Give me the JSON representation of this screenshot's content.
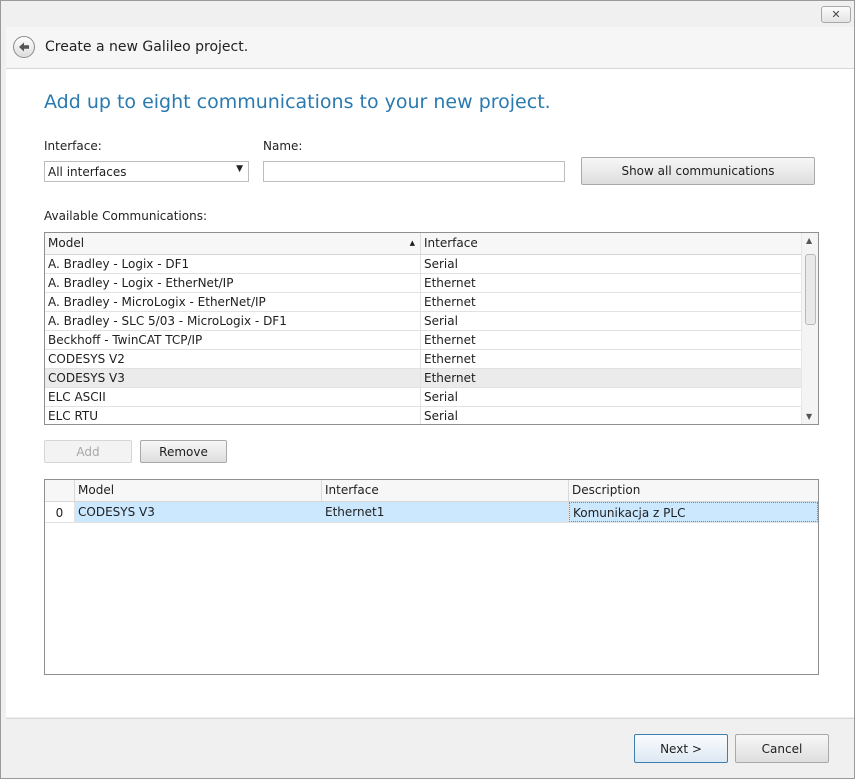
{
  "window": {
    "close_icon": "close-icon",
    "close_glyph": "✕"
  },
  "header": {
    "back_glyph": "🡐",
    "title": "Create a new Galileo project."
  },
  "page": {
    "heading": "Add up to eight communications to your new project."
  },
  "filters": {
    "interface_label": "Interface:",
    "interface_value": "All interfaces",
    "name_label": "Name:",
    "name_value": "",
    "show_all_button": "Show all communications"
  },
  "available": {
    "label": "Available Communications:",
    "columns": {
      "model": "Model",
      "sort_glyph": "▲",
      "interface": "Interface"
    },
    "rows": [
      {
        "model": "A. Bradley - Logix - DF1",
        "interface": "Serial"
      },
      {
        "model": "A. Bradley - Logix - EtherNet/IP",
        "interface": "Ethernet"
      },
      {
        "model": "A. Bradley - MicroLogix - EtherNet/IP",
        "interface": "Ethernet"
      },
      {
        "model": "A. Bradley - SLC 5/03 - MicroLogix - DF1",
        "interface": "Serial"
      },
      {
        "model": "Beckhoff - TwinCAT TCP/IP",
        "interface": "Ethernet"
      },
      {
        "model": "CODESYS V2",
        "interface": "Ethernet"
      },
      {
        "model": "CODESYS V3",
        "interface": "Ethernet"
      },
      {
        "model": "ELC ASCII",
        "interface": "Serial"
      },
      {
        "model": "ELC RTU",
        "interface": "Serial"
      }
    ],
    "selected_index": 6,
    "scroll_up": "▲",
    "scroll_down": "▼"
  },
  "actions": {
    "add": "Add",
    "remove": "Remove"
  },
  "selected": {
    "columns": {
      "index": "",
      "model": "Model",
      "interface": "Interface",
      "description": "Description"
    },
    "rows": [
      {
        "index": "0",
        "model": "CODESYS V3",
        "interface": "Ethernet1",
        "description": "Komunikacja z PLC"
      }
    ]
  },
  "footer": {
    "next": "Next >",
    "cancel": "Cancel"
  },
  "colors": {
    "heading": "#2a7ab0",
    "row_selected": "#cce8ff",
    "row_focus": "#3399ff"
  }
}
